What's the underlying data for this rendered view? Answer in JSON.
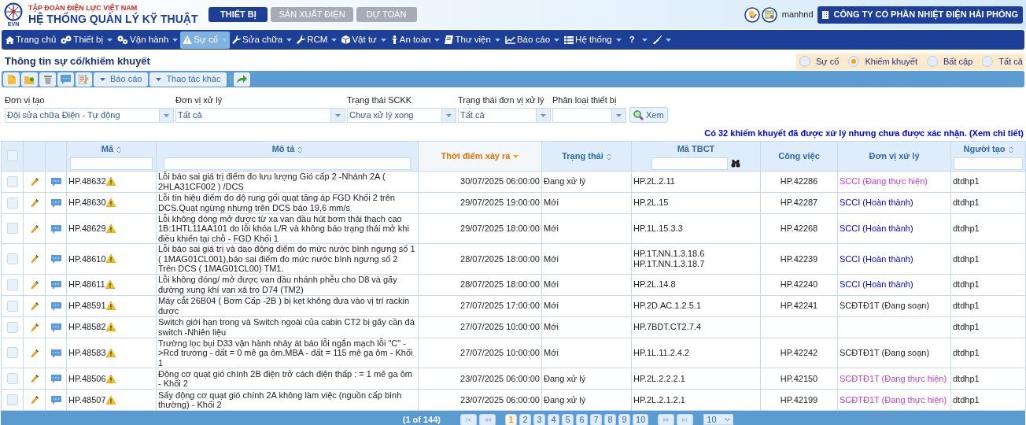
{
  "header": {
    "org": "TẬP ĐOÀN ĐIỆN LỰC VIỆT NAM",
    "system": "HỆ THỐNG QUẢN LÝ KỸ THUẬT",
    "logo_text": "EVN",
    "user": "manhnd",
    "company": "CÔNG TY CỔ PHẦN NHIỆT ĐIỆN HẢI PHÒNG"
  },
  "modules": [
    {
      "label": "THIẾT BỊ",
      "selected": true
    },
    {
      "label": "SẢN XUẤT ĐIỆN",
      "selected": false
    },
    {
      "label": "DỰ TOÁN",
      "selected": false
    }
  ],
  "nav": [
    {
      "label": "Trang chủ",
      "selected": false,
      "dropdown": false
    },
    {
      "label": "Thiết bị",
      "selected": false,
      "dropdown": true
    },
    {
      "label": "Vận hành",
      "selected": false,
      "dropdown": true
    },
    {
      "label": "Sự cố",
      "selected": true,
      "dropdown": true
    },
    {
      "label": "Sửa chữa",
      "selected": false,
      "dropdown": true
    },
    {
      "label": "RCM",
      "selected": false,
      "dropdown": true
    },
    {
      "label": "Vật tư",
      "selected": false,
      "dropdown": true
    },
    {
      "label": "An toàn",
      "selected": false,
      "dropdown": true
    },
    {
      "label": "Thư viện",
      "selected": false,
      "dropdown": true
    },
    {
      "label": "Báo cáo",
      "selected": false,
      "dropdown": true
    },
    {
      "label": "Hệ thống",
      "selected": false,
      "dropdown": true
    },
    {
      "label": "?",
      "selected": false,
      "dropdown": true
    },
    {
      "selected": false,
      "dropdown": true
    }
  ],
  "page_title": "Thông tin sự cố/khiếm khuyết",
  "type_filter": [
    {
      "label": "Sự cố",
      "selected": false
    },
    {
      "label": "Khiếm khuyết",
      "selected": true
    },
    {
      "label": "Bất cập",
      "selected": false
    },
    {
      "label": "Tất cả",
      "selected": false
    }
  ],
  "toolbar": {
    "menus": [
      "Báo cáo",
      "Thao tác khác"
    ]
  },
  "filters": [
    {
      "label": "Đơn vị tạo",
      "value": "Đội sửa chữa Điện - Tự động"
    },
    {
      "label": "Đơn vị xử lý",
      "value": "Tất cả"
    },
    {
      "label": "Trạng thái SCKK",
      "value": "Chưa xử lý xong"
    },
    {
      "label": "Trạng thái đơn vị xử lý",
      "value": "Tất cả"
    },
    {
      "label": "Phân loại thiết bị"
    }
  ],
  "view_button": "Xem",
  "notice": "Có 32 khiếm khuyết đã được xử lý nhưng chưa được xác nhận. (Xem chi tiết)",
  "table": {
    "select_all_checked": false,
    "columns": [
      {
        "label": "Mã",
        "sortable": true,
        "sorted": false,
        "filter": true
      },
      {
        "label": "Mô tả",
        "sortable": true,
        "sorted": false,
        "filter": true
      },
      {
        "label": "Thời điểm xảy ra",
        "sortable": true,
        "sorted": true,
        "filter": false
      },
      {
        "label": "Trạng thái",
        "sortable": true,
        "sorted": false,
        "filter": false
      },
      {
        "label": "Mã TBCT",
        "sortable": false,
        "filter": true,
        "search_button": true
      },
      {
        "label": "Công việc",
        "sortable": false,
        "filter": false
      },
      {
        "label": "Đơn vị xử lý",
        "sortable": false,
        "filter": false
      },
      {
        "label": "Người tạo",
        "sortable": true,
        "sorted": false,
        "filter": true
      }
    ],
    "rows": [
      {
        "code": "HP.48632",
        "description": "Lỗi báo sai giá trị điểm đo lưu lượng Gió cấp 2 -Nhánh 2A ( 2HLA31CF002 ) /DCS",
        "time": "30/07/2025 06:00:00",
        "status": "Đang xử lý",
        "tbct": [
          "HP.2L.2.11"
        ],
        "job": "HP.42286",
        "unit": {
          "text": "SCCI (Đang thực hiện)",
          "color": "#c040d0"
        },
        "creator": "dtdhp1",
        "checked": false
      },
      {
        "code": "HP.48630",
        "description": "Lỗi tín hiệu điểm đo độ rung gối quạt tăng áp FGD Khối 2 trên DCS.Quạt ngừng nhưng trên DCS báo 19,6 mm/s",
        "time": "29/07/2025 19:00:00",
        "status": "Mới",
        "tbct": [
          "HP.2L.15"
        ],
        "job": "HP.42287",
        "unit": {
          "text": "SCCI (Hoàn thành)",
          "color": "#0000ff"
        },
        "creator": "dtdhp1",
        "checked": false
      },
      {
        "code": "HP.48629",
        "description": "Lỗi không đóng mở được từ xa van đầu hút bơm thải thạch cao 1B:1HTL11AA101 do lỗi khóa L/R và không báo trạng thái mở khi điều khiển tại chỗ - FGD Khối 1",
        "time": "29/07/2025 18:00:00",
        "status": "Mới",
        "tbct": [
          "HP.1L.15.3.3"
        ],
        "job": "HP.42268",
        "unit": {
          "text": "SCCI (Hoàn thành)",
          "color": "#0000ff"
        },
        "creator": "dtdhp1",
        "checked": false
      },
      {
        "code": "HP.48610",
        "description": "Lỗi báo sai giá trị và dao động điểm đo mức nước bình ngưng số 1 ( 1MAG01CL001),báo sai điểm đo mức nước bình ngưng số 2 Trên DCS ( 1MAG01CL00) TM1.",
        "time": "28/07/2025 18:00:00",
        "status": "Mới",
        "tbct": [
          "HP.1T.NN.1.3.18.6",
          "HP.1T.NN.1.3.18.7"
        ],
        "job": "HP.42239",
        "unit": {
          "text": "SCCI (Hoàn thành)",
          "color": "#0000ff"
        },
        "creator": "dtdhp1",
        "checked": false
      },
      {
        "code": "HP.48611",
        "description": "Lỗi không đóng/ mở được van đầu nhánh phễu cho D8 và gãy đường xung khí van xả tro D74 (TM2)",
        "time": "28/07/2025 18:00:00",
        "status": "Mới",
        "tbct": [
          "HP.2L.14.8"
        ],
        "job": "HP.42240",
        "unit": {
          "text": "SCCI (Hoàn thành)",
          "color": "#0000ff"
        },
        "creator": "dtdhp1",
        "checked": false
      },
      {
        "code": "HP.48591",
        "description": "Máy cắt 26B04 ( Bơm Cấp -2B ) bị kẹt không đưa vào vị trí rackin được",
        "time": "27/07/2025 17:00:00",
        "status": "Mới",
        "tbct": [
          "HP.2D.AC.1.2.5.1"
        ],
        "job": "HP.42241",
        "unit": {
          "text": "SCĐTĐ1T (Đang soạn)",
          "color": "#222222"
        },
        "creator": "dtdhp1",
        "checked": false
      },
      {
        "code": "HP.48582",
        "description": "Switch giới hạn trong và Switch ngoài của cabin CT2 bị gãy cần đá switch -Nhiên liệu",
        "time": "27/07/2025 10:00:00",
        "status": "Mới",
        "tbct": [
          "HP.7BDT.CT2.7.4"
        ],
        "creator": "dtdhp1",
        "checked": false
      },
      {
        "code": "HP.48583",
        "description": "Trường lọc bụi D33 vận hành nhảy át báo lỗi ngắn mạch lỗi \"C\" ->Rcđ trường - đất = 0 mê ga ôm.MBA - đất = 115 mê ga ôm - Khối 1",
        "time": "27/07/2025 10:00:00",
        "status": "Mới",
        "tbct": [
          "HP.1L.11.2.4.2"
        ],
        "job": "HP.42242",
        "unit": {
          "text": "SCĐTĐ1T (Đang soạn)",
          "color": "#222222"
        },
        "creator": "dtdhp1",
        "checked": false
      },
      {
        "code": "HP.48506",
        "description": "Động cơ quạt gió chính 2B điện trở cách điện thấp : = 1 mê ga ôm - Khối 2",
        "time": "23/07/2025 06:00:00",
        "status": "Đang xử lý",
        "tbct": [
          "HP.2L.2.2.2.1"
        ],
        "job": "HP.42150",
        "unit": {
          "text": "SCĐTĐ1T (Đang thực hiện)",
          "color": "#c040d0"
        },
        "creator": "dtdhp1",
        "checked": false
      },
      {
        "code": "HP.48507",
        "description": "Sấy động cơ quạt gió chính 2A không làm việc (nguồn cấp bình thường) - Khối 2",
        "time": "23/07/2025 06:00:00",
        "status": "Đang xử lý",
        "tbct": [
          "HP.2L.2.1.2.1"
        ],
        "job": "HP.42199",
        "unit": {
          "text": "SCĐTĐ1T (Đang thực hiện)",
          "color": "#c040d0"
        },
        "creator": "dtdhp1",
        "checked": false
      }
    ]
  },
  "pagination": {
    "summary": "(1 of 144)",
    "pages": [
      {
        "label": "1",
        "selected": true
      },
      {
        "label": "2",
        "selected": false
      },
      {
        "label": "3",
        "selected": false
      },
      {
        "label": "4",
        "selected": false
      },
      {
        "label": "5",
        "selected": false
      },
      {
        "label": "6",
        "selected": false
      },
      {
        "label": "7",
        "selected": false
      },
      {
        "label": "8",
        "selected": false
      },
      {
        "label": "9",
        "selected": false
      },
      {
        "label": "10",
        "selected": false
      }
    ],
    "per_page": "10"
  }
}
